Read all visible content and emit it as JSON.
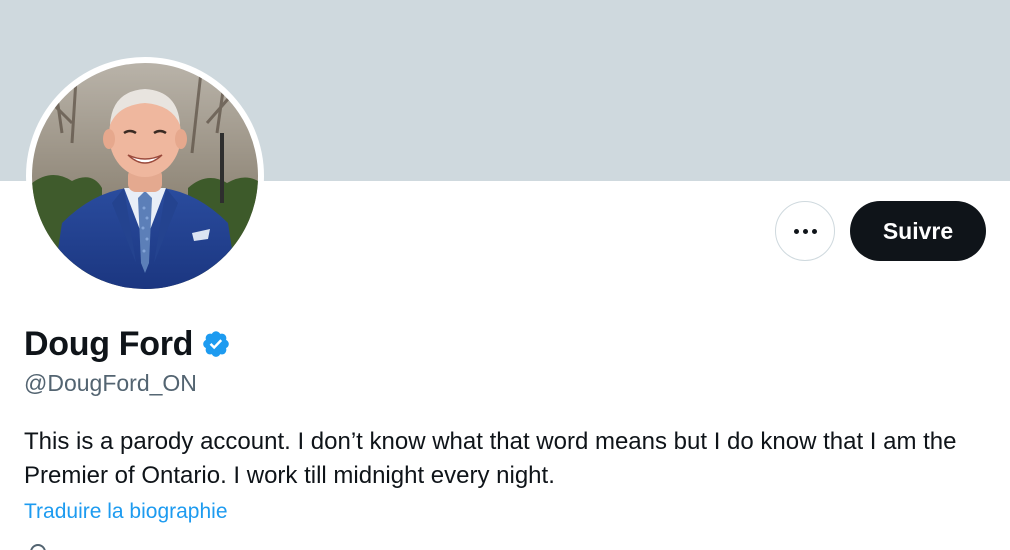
{
  "profile": {
    "display_name": "Doug Ford",
    "handle": "@DougFord_ON",
    "verified": true,
    "verified_icon": "verified-badge-icon",
    "bio": "This is a parody account. I don’t know what that word means but I do know that I am the Premier of Ontario. I work till midnight every night.",
    "translate_bio_label": "Traduire la biographie"
  },
  "actions": {
    "more_icon": "more-horizontal-icon",
    "follow_label": "Suivre"
  },
  "colors": {
    "banner": "#cfd9de",
    "accent": "#1d9bf0",
    "primary_text": "#0f1419",
    "secondary_text": "#536471",
    "follow_button_bg": "#0f1419"
  }
}
